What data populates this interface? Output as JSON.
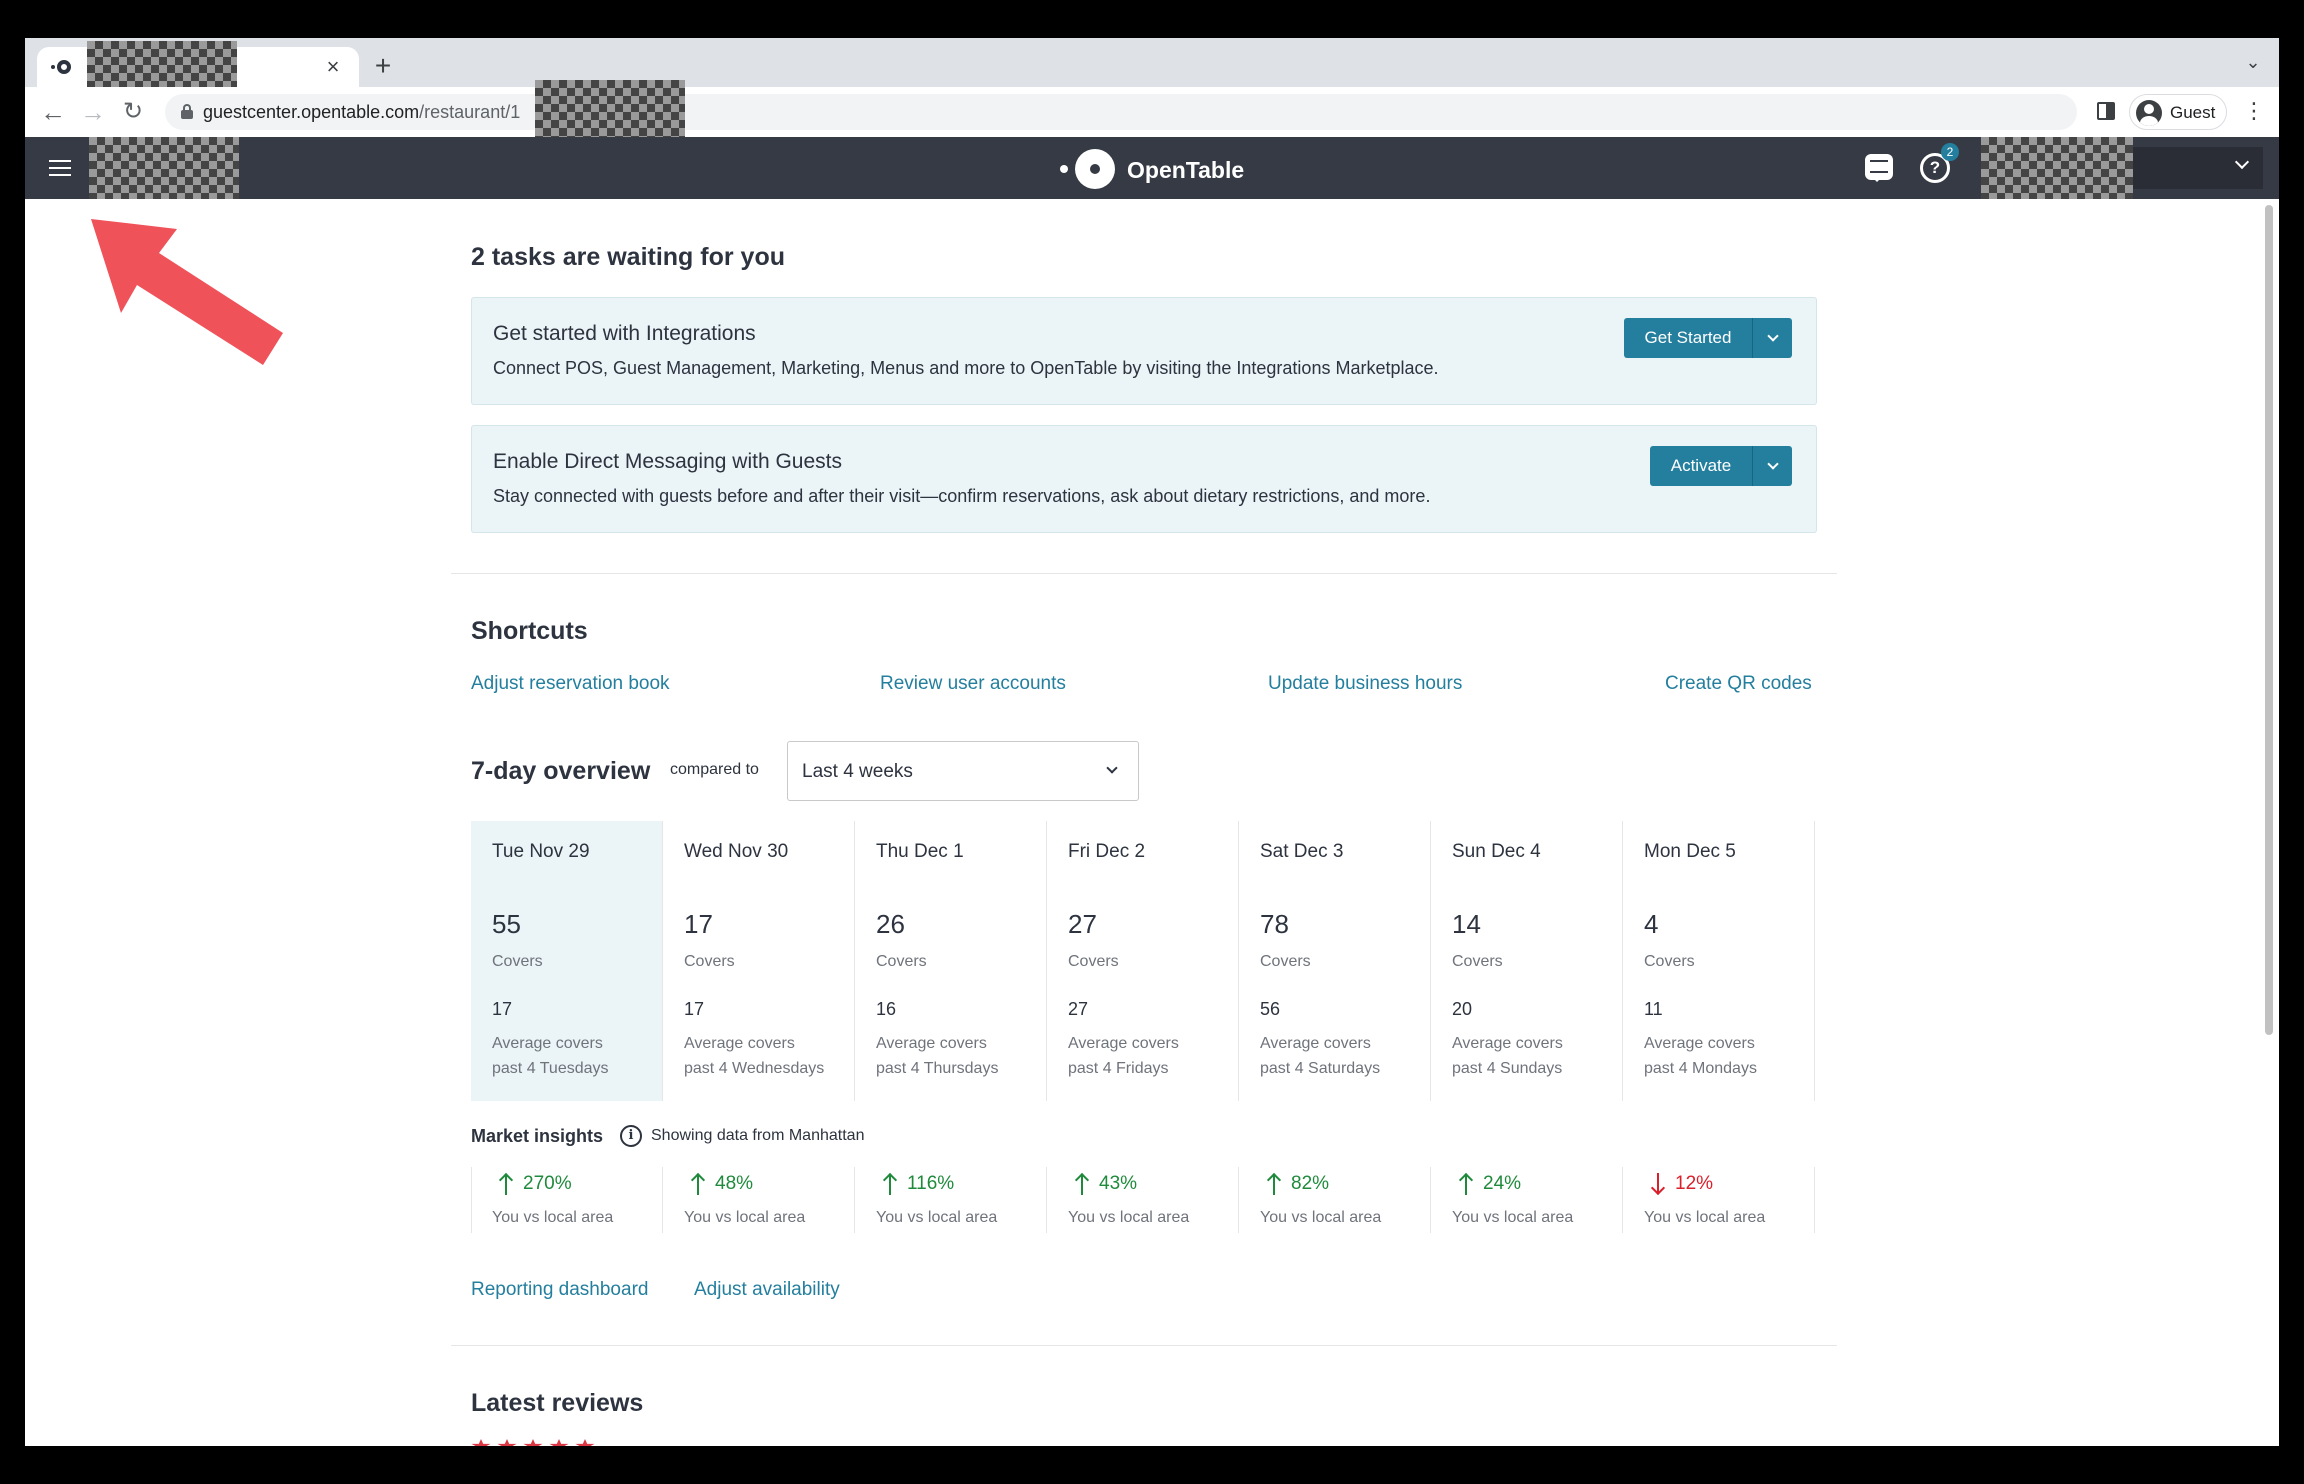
{
  "browser": {
    "tab_close": "×",
    "new_tab": "+",
    "tab_menu": "⌄",
    "url_host": "guestcenter.opentable.com",
    "url_path": "/restaurant/1",
    "profile_label": "Guest",
    "menu_glyph": "⋮",
    "back_glyph": "←",
    "forward_glyph": "→",
    "reload_glyph": "↻"
  },
  "app": {
    "brand": "OpenTable",
    "help_badge": "2",
    "help_glyph": "?"
  },
  "tasks": {
    "heading": "2 tasks are waiting for you",
    "items": [
      {
        "title": "Get started with Integrations",
        "description": "Connect POS, Guest Management, Marketing, Menus and more to OpenTable by visiting the Integrations Marketplace.",
        "button": "Get Started"
      },
      {
        "title": "Enable Direct Messaging with Guests",
        "description": "Stay connected with guests before and after their visit—confirm reservations, ask about dietary restrictions, and more.",
        "button": "Activate"
      }
    ]
  },
  "shortcuts": {
    "heading": "Shortcuts",
    "links": [
      "Adjust reservation book",
      "Review user accounts",
      "Update business hours",
      "Create QR codes"
    ]
  },
  "overview": {
    "heading": "7-day overview",
    "compared_label": "compared to",
    "range_value": "Last 4 weeks",
    "covers_label": "Covers",
    "avg_label": "Average covers",
    "days": [
      {
        "name": "Tue Nov 29",
        "covers": "55",
        "avg": "17",
        "past": "past 4 Tuesdays"
      },
      {
        "name": "Wed Nov 30",
        "covers": "17",
        "avg": "17",
        "past": "past 4 Wednesdays"
      },
      {
        "name": "Thu Dec 1",
        "covers": "26",
        "avg": "16",
        "past": "past 4 Thursdays"
      },
      {
        "name": "Fri Dec 2",
        "covers": "27",
        "avg": "27",
        "past": "past 4 Fridays"
      },
      {
        "name": "Sat Dec 3",
        "covers": "78",
        "avg": "56",
        "past": "past 4 Saturdays"
      },
      {
        "name": "Sun Dec 4",
        "covers": "14",
        "avg": "20",
        "past": "past 4 Sundays"
      },
      {
        "name": "Mon Dec 5",
        "covers": "4",
        "avg": "11",
        "past": "past 4 Mondays"
      }
    ]
  },
  "market": {
    "title": "Market insights",
    "info_glyph": "i",
    "note": "Showing data from Manhattan",
    "compare_label": "You vs local area",
    "items": [
      {
        "pct": "270%",
        "dir": "up"
      },
      {
        "pct": "48%",
        "dir": "up"
      },
      {
        "pct": "116%",
        "dir": "up"
      },
      {
        "pct": "43%",
        "dir": "up"
      },
      {
        "pct": "82%",
        "dir": "up"
      },
      {
        "pct": "24%",
        "dir": "up"
      },
      {
        "pct": "12%",
        "dir": "down"
      }
    ],
    "colors": {
      "up": "#1f8a3b",
      "down": "#d9202b"
    }
  },
  "footer_links": {
    "reporting": "Reporting dashboard",
    "availability": "Adjust availability"
  },
  "reviews": {
    "heading": "Latest reviews"
  },
  "colors": {
    "accent": "#247f9e",
    "header_bg": "#363a45",
    "annotation_arrow": "#f0525a"
  }
}
